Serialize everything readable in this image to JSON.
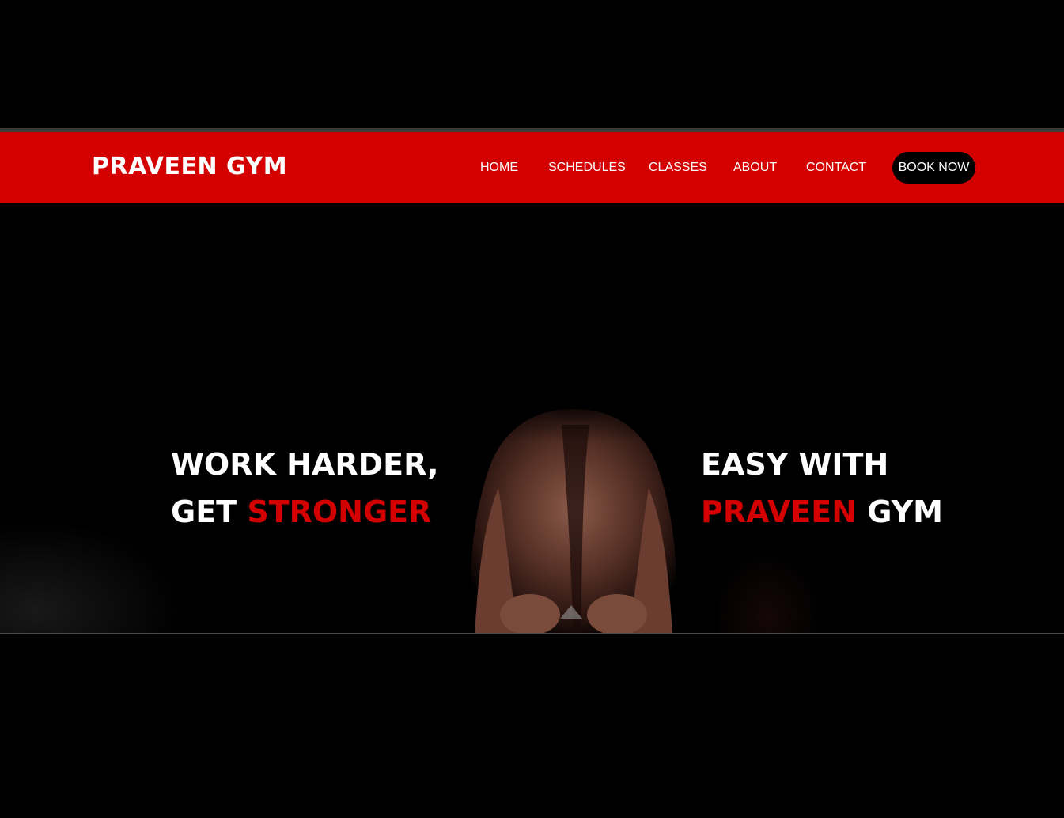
{
  "header": {
    "brand": "PRAVEEN GYM",
    "nav": {
      "home": "HOME",
      "schedules": "SCHEDULES",
      "classes": "CLASSES",
      "about": "ABOUT",
      "contact": "CONTACT"
    },
    "cta_label": "BOOK NOW"
  },
  "hero": {
    "left_line1": "WORK HARDER,",
    "left_line2_prefix": "GET ",
    "left_line2_highlight": "STRONGER",
    "right_line1": "EASY WITH",
    "right_line2_highlight": "PRAVEEN",
    "right_line2_suffix": " GYM"
  },
  "colors": {
    "background": "#000000",
    "brand_red": "#d40000",
    "text": "#ffffff",
    "button_bg": "#000000"
  },
  "icons": {
    "hero_image": "athlete-photo"
  }
}
